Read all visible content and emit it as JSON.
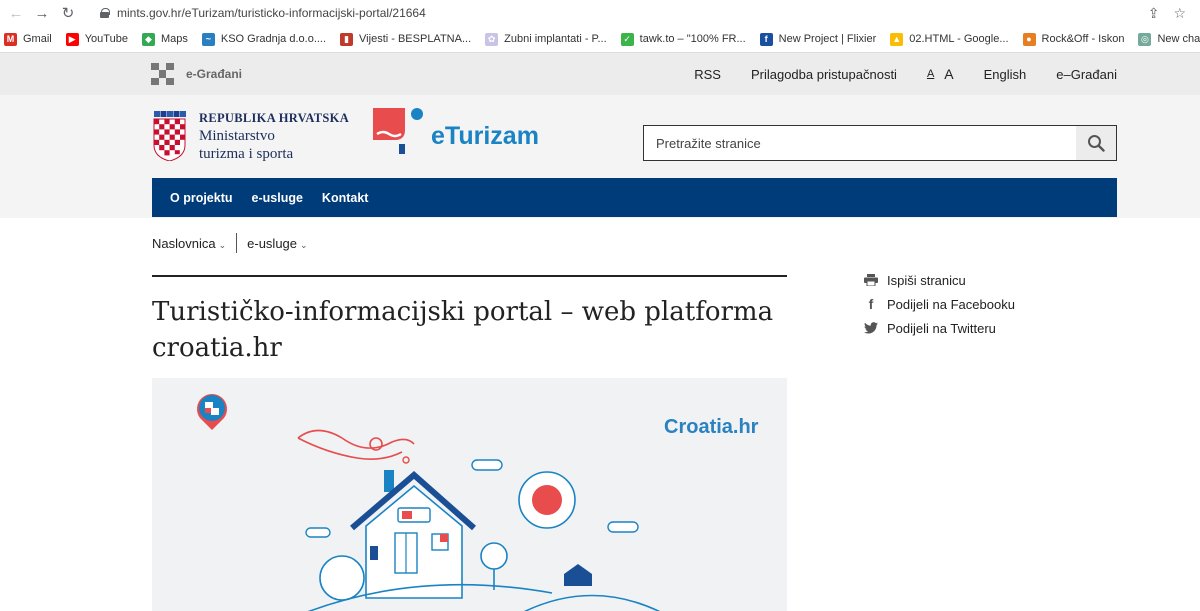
{
  "browser": {
    "url": "mints.gov.hr/eTurizam/turisticko-informacijski-portal/21664",
    "bookmarks": [
      {
        "label": "Gmail",
        "icon": "gmail-icon",
        "color": "#d93025",
        "glyph": "M"
      },
      {
        "label": "YouTube",
        "icon": "youtube-icon",
        "color": "#ff0000",
        "glyph": "▶"
      },
      {
        "label": "Maps",
        "icon": "maps-icon",
        "color": "#34a853",
        "glyph": "◆"
      },
      {
        "label": "KSO Gradnja d.o.o....",
        "icon": "kso-icon",
        "color": "#2a7fc0",
        "glyph": "~"
      },
      {
        "label": "Vijesti - BESPLATNA...",
        "icon": "vijesti-icon",
        "color": "#c0392b",
        "glyph": "▮"
      },
      {
        "label": "Zubni implantati - P...",
        "icon": "tooth-icon",
        "color": "#c9c3e6",
        "glyph": "✿"
      },
      {
        "label": "tawk.to – \"100% FR...",
        "icon": "tawk-icon",
        "color": "#3bb54a",
        "glyph": "✓"
      },
      {
        "label": "New Project | Flixier",
        "icon": "flixier-icon",
        "color": "#1a4fa0",
        "glyph": "f"
      },
      {
        "label": "02.HTML - Google...",
        "icon": "drive-icon",
        "color": "#fbbc04",
        "glyph": "▲"
      },
      {
        "label": "Rock&Off - Iskon",
        "icon": "iskon-icon",
        "color": "#e67e22",
        "glyph": "●"
      },
      {
        "label": "New chat",
        "icon": "chat-icon",
        "color": "#74aa9c",
        "glyph": "◎"
      }
    ]
  },
  "utility": {
    "brand": "e-Građani",
    "rss": "RSS",
    "accessibility": "Prilagodba pristupačnosti",
    "font_small": "A",
    "font_large": "A",
    "english": "English",
    "egradani": "e–Građani"
  },
  "header": {
    "rh_line1": "REPUBLIKA HRVATSKA",
    "rh_line2": "Ministarstvo",
    "rh_line3": "turizma i sporta",
    "eturizam": "eTurizam",
    "search_placeholder": "Pretražite stranice"
  },
  "nav": {
    "items": [
      "O projektu",
      "e-usluge",
      "Kontakt"
    ]
  },
  "breadcrumb": {
    "home": "Naslovnica",
    "section": "e-usluge"
  },
  "page": {
    "title": "Turističko-informacijski portal – web platforma croatia.hr",
    "hero_label": "Croatia.hr"
  },
  "share": {
    "print": "Ispiši stranicu",
    "facebook": "Podijeli na Facebooku",
    "twitter": "Podijeli na Twitteru"
  },
  "colors": {
    "nav_bg": "#003b7a",
    "brand_blue": "#1a83c4",
    "brand_red": "#e84c4c"
  }
}
